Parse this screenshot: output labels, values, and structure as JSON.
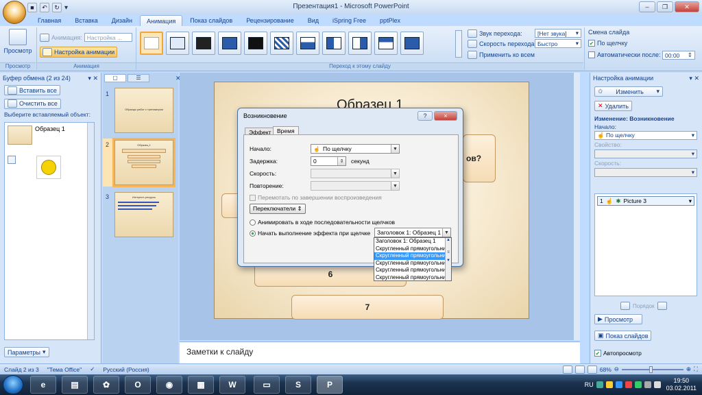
{
  "window": {
    "title": "Презентация1 - Microsoft PowerPoint"
  },
  "tabs": [
    "Главная",
    "Вставка",
    "Дизайн",
    "Анимация",
    "Показ слайдов",
    "Рецензирование",
    "Вид",
    "iSpring Free",
    "pptPlex"
  ],
  "active_tab": "Анимация",
  "ribbon": {
    "preview_label": "Просмотр",
    "preview_group": "Просмотр",
    "animation_label": "Анимация:",
    "animation_value": "Настройка ...",
    "custom_anim_label": "Настройка анимации",
    "animation_group": "Анимация",
    "transition_group": "Переход к этому слайду",
    "sound_label": "Звук перехода:",
    "sound_value": "[Нет звука]",
    "speed_label": "Скорость перехода:",
    "speed_value": "Быстро",
    "apply_all": "Применить ко всем",
    "change_slide": "Смена слайда",
    "on_click": "По щелчку",
    "auto_after": "Автоматически после:",
    "auto_time": "00:00"
  },
  "clipboard": {
    "title": "Буфер обмена (2 из 24)",
    "paste_all": "Вставить все",
    "clear_all": "Очистить все",
    "select_label": "Выберите вставляемый объект:",
    "item1": "Образец 1",
    "params": "Параметры"
  },
  "thumbs": {
    "n1": "1",
    "t1": "Образцы работ с тренажером",
    "n2": "2",
    "t2": "Образец 1",
    "n3": "3",
    "t3": "Интернет-ресурсы"
  },
  "slide": {
    "title_partial": "Образец 1",
    "question_tail": "ов?",
    "box6": "6",
    "box7": "7"
  },
  "notes": "Заметки к слайду",
  "dialog": {
    "title": "Возникновение",
    "help": "?",
    "close": "×",
    "tab_effect": "Эффект",
    "tab_time": "Время",
    "start_label": "Начало:",
    "start_value": "По щелчку",
    "delay_label": "Задержка:",
    "delay_value": "0",
    "delay_unit": "секунд",
    "speed_label": "Скорость:",
    "repeat_label": "Повторение:",
    "rewind": "Перемотать по завершении воспроизведения",
    "triggers": "Переключатели",
    "opt1": "Анимировать в ходе последовательности щелчков",
    "opt2": "Начать выполнение эффекта при щелчке",
    "trigger_value": "Заголовок 1: Образец 1",
    "options": [
      "Заголовок 1: Образец 1",
      "Скругленный прямоугольник",
      "Скругленный прямоугольник",
      "Скругленный прямоугольник",
      "Скругленный прямоугольник",
      "Скругленный прямоугольник"
    ],
    "selected_index": 2
  },
  "anim_pane": {
    "title": "Настройка анимации",
    "change": "Изменить",
    "delete": "Удалить",
    "change_heading": "Изменение: Возникновение",
    "start_label": "Начало:",
    "start_value": "По щелчку",
    "property_label": "Свойство:",
    "speed_label": "Скорость:",
    "item_num": "1",
    "item_name": "Picture 3",
    "order": "Порядок",
    "play": "Просмотр",
    "slideshow": "Показ слайдов",
    "autopreview": "Автопросмотр"
  },
  "status": {
    "slide": "Слайд 2 из 3",
    "theme": "\"Тема Office\"",
    "lang": "Русский (Россия)",
    "zoom": "68%"
  },
  "taskbar": {
    "lang": "RU",
    "time": "19:50",
    "date": "03.02.2011"
  }
}
